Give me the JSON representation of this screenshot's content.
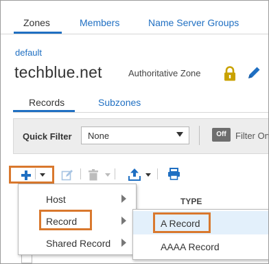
{
  "top_tabs": [
    {
      "label": "Zones",
      "active": true
    },
    {
      "label": "Members",
      "active": false
    },
    {
      "label": "Name Server Groups",
      "active": false
    }
  ],
  "breadcrumb": "default",
  "zone": {
    "name": "techblue.net",
    "type": "Authoritative Zone"
  },
  "sub_tabs": [
    {
      "label": "Records",
      "active": true
    },
    {
      "label": "Subzones",
      "active": false
    }
  ],
  "quick_filter": {
    "label": "Quick Filter",
    "value": "None",
    "toggle": "Off",
    "filter_text": "Filter On"
  },
  "table": {
    "type_header": "TYPE"
  },
  "add_menu": [
    {
      "label": "Host",
      "has_submenu": true
    },
    {
      "label": "Record",
      "has_submenu": true,
      "highlighted": true
    },
    {
      "label": "Shared Record",
      "has_submenu": true
    }
  ],
  "record_submenu": [
    {
      "label": "A Record",
      "selected": true
    },
    {
      "label": "AAAA Record",
      "selected": false
    }
  ],
  "colors": {
    "accent": "#1f6fc2",
    "highlight_box": "#d9782d",
    "lock": "#c9a200",
    "menu_selected_bg": "#e3f0fb"
  },
  "icons": [
    "add-icon",
    "edit-icon",
    "delete-icon",
    "export-icon",
    "print-icon",
    "lock-icon",
    "pencil-icon"
  ]
}
